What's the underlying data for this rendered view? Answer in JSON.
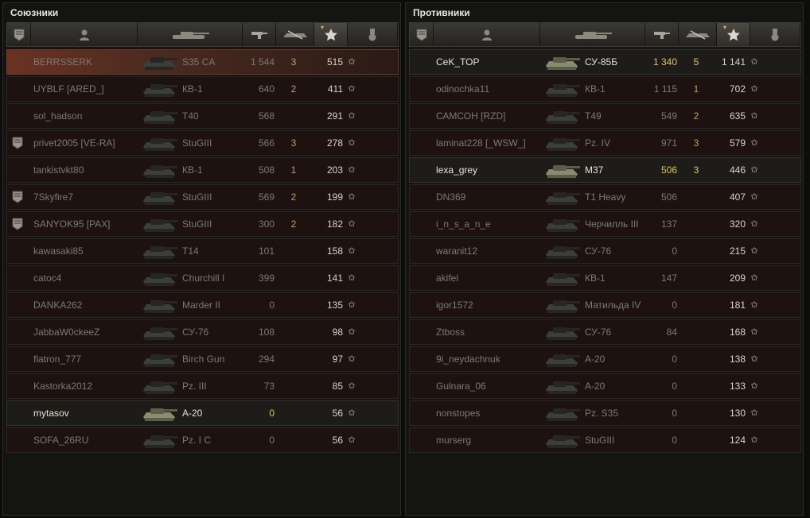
{
  "panels": {
    "allies": {
      "title": "Союзники",
      "rows": [
        {
          "name": "BERRSSERK",
          "vehicle": "S35 CA",
          "damage": "1 544",
          "kills": "3",
          "exp": "515",
          "alive": false,
          "me": true,
          "badge": false
        },
        {
          "name": "UYBLF [ARED_]",
          "vehicle": "КВ-1",
          "damage": "640",
          "kills": "2",
          "exp": "411",
          "alive": false,
          "me": false,
          "badge": false
        },
        {
          "name": "sol_hadson",
          "vehicle": "T40",
          "damage": "568",
          "kills": "",
          "exp": "291",
          "alive": false,
          "me": false,
          "badge": false
        },
        {
          "name": "privet2005 [VE-RA]",
          "vehicle": "StuGIII",
          "damage": "566",
          "kills": "3",
          "exp": "278",
          "alive": false,
          "me": false,
          "badge": true
        },
        {
          "name": "tankistvkt80",
          "vehicle": "КВ-1",
          "damage": "508",
          "kills": "1",
          "exp": "203",
          "alive": false,
          "me": false,
          "badge": false
        },
        {
          "name": "7Skyfire7",
          "vehicle": "StuGIII",
          "damage": "569",
          "kills": "2",
          "exp": "199",
          "alive": false,
          "me": false,
          "badge": true
        },
        {
          "name": "SANYOK95 [PAX]",
          "vehicle": "StuGIII",
          "damage": "300",
          "kills": "2",
          "exp": "182",
          "alive": false,
          "me": false,
          "badge": true
        },
        {
          "name": "kawasaki85",
          "vehicle": "T14",
          "damage": "101",
          "kills": "",
          "exp": "158",
          "alive": false,
          "me": false,
          "badge": false
        },
        {
          "name": "catoc4",
          "vehicle": "Churchill I",
          "damage": "399",
          "kills": "",
          "exp": "141",
          "alive": false,
          "me": false,
          "badge": false
        },
        {
          "name": "DANKA262",
          "vehicle": "Marder II",
          "damage": "0",
          "kills": "",
          "exp": "135",
          "alive": false,
          "me": false,
          "badge": false
        },
        {
          "name": "JabbaW0ckeeZ",
          "vehicle": "СУ-76",
          "damage": "108",
          "kills": "",
          "exp": "98",
          "alive": false,
          "me": false,
          "badge": false
        },
        {
          "name": "flatron_777",
          "vehicle": "Birch Gun",
          "damage": "294",
          "kills": "",
          "exp": "97",
          "alive": false,
          "me": false,
          "badge": false
        },
        {
          "name": "Kastorka2012",
          "vehicle": "Pz. III",
          "damage": "73",
          "kills": "",
          "exp": "85",
          "alive": false,
          "me": false,
          "badge": false
        },
        {
          "name": "mytasov",
          "vehicle": "A-20",
          "damage": "0",
          "kills": "",
          "exp": "56",
          "alive": true,
          "me": false,
          "badge": false
        },
        {
          "name": "SOFA_26RU",
          "vehicle": "Pz. I C",
          "damage": "0",
          "kills": "",
          "exp": "56",
          "alive": false,
          "me": false,
          "badge": false
        }
      ]
    },
    "enemies": {
      "title": "Противники",
      "rows": [
        {
          "name": "CeK_TOP",
          "vehicle": "СУ-85Б",
          "damage": "1 340",
          "kills": "5",
          "exp": "1 141",
          "alive": true,
          "me": false,
          "badge": false
        },
        {
          "name": "odinochka11",
          "vehicle": "КВ-1",
          "damage": "1 115",
          "kills": "1",
          "exp": "702",
          "alive": false,
          "me": false,
          "badge": false
        },
        {
          "name": "САМСОН [RZD]",
          "vehicle": "T49",
          "damage": "549",
          "kills": "2",
          "exp": "635",
          "alive": false,
          "me": false,
          "badge": false
        },
        {
          "name": "laminat228 [_WSW_]",
          "vehicle": "Pz. IV",
          "damage": "971",
          "kills": "3",
          "exp": "579",
          "alive": false,
          "me": false,
          "badge": false
        },
        {
          "name": "lexa_grey",
          "vehicle": "M37",
          "damage": "506",
          "kills": "3",
          "exp": "446",
          "alive": true,
          "me": false,
          "badge": false
        },
        {
          "name": "DN369",
          "vehicle": "T1 Heavy",
          "damage": "506",
          "kills": "",
          "exp": "407",
          "alive": false,
          "me": false,
          "badge": false
        },
        {
          "name": "i_n_s_a_n_e",
          "vehicle": "Черчилль III",
          "damage": "137",
          "kills": "",
          "exp": "320",
          "alive": false,
          "me": false,
          "badge": false
        },
        {
          "name": "waranit12",
          "vehicle": "СУ-76",
          "damage": "0",
          "kills": "",
          "exp": "215",
          "alive": false,
          "me": false,
          "badge": false
        },
        {
          "name": "akifel",
          "vehicle": "КВ-1",
          "damage": "147",
          "kills": "",
          "exp": "209",
          "alive": false,
          "me": false,
          "badge": false
        },
        {
          "name": "igor1572",
          "vehicle": "Матильда IV",
          "damage": "0",
          "kills": "",
          "exp": "181",
          "alive": false,
          "me": false,
          "badge": false
        },
        {
          "name": "Ztboss",
          "vehicle": "СУ-76",
          "damage": "84",
          "kills": "",
          "exp": "168",
          "alive": false,
          "me": false,
          "badge": false
        },
        {
          "name": "9i_neydachnuk",
          "vehicle": "A-20",
          "damage": "0",
          "kills": "",
          "exp": "138",
          "alive": false,
          "me": false,
          "badge": false
        },
        {
          "name": "Gulnara_06",
          "vehicle": "A-20",
          "damage": "0",
          "kills": "",
          "exp": "133",
          "alive": false,
          "me": false,
          "badge": false
        },
        {
          "name": "nonstopes",
          "vehicle": "Pz. S35",
          "damage": "0",
          "kills": "",
          "exp": "130",
          "alive": false,
          "me": false,
          "badge": false
        },
        {
          "name": "murserg",
          "vehicle": "StuGIII",
          "damage": "0",
          "kills": "",
          "exp": "124",
          "alive": false,
          "me": false,
          "badge": false
        }
      ]
    }
  },
  "header_icons": [
    "badge-icon",
    "player-icon",
    "vehicle-icon",
    "damage-icon",
    "kills-icon",
    "experience-star-icon",
    "medal-icon"
  ],
  "sorted_column": "experience",
  "colors": {
    "alive_text": "#e6e2d6",
    "dead_text": "#7d7970",
    "damage_highlight": "#e0c45e",
    "player_row": "#6a3223"
  }
}
